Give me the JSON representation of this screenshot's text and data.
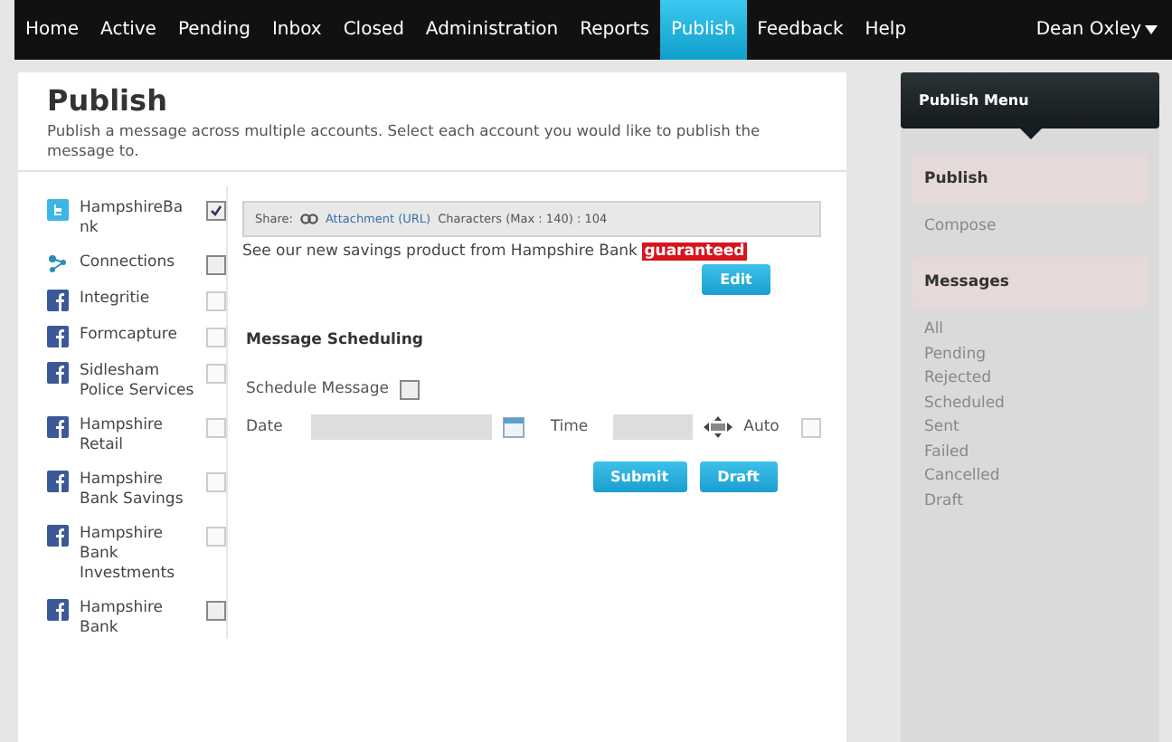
{
  "nav": {
    "items": [
      {
        "label": "Home",
        "selected": false
      },
      {
        "label": "Active",
        "selected": false
      },
      {
        "label": "Pending",
        "selected": false
      },
      {
        "label": "Inbox",
        "selected": false
      },
      {
        "label": "Closed",
        "selected": false
      },
      {
        "label": "Administration",
        "selected": false
      },
      {
        "label": "Reports",
        "selected": false
      },
      {
        "label": "Publish",
        "selected": true
      },
      {
        "label": "Feedback",
        "selected": false
      },
      {
        "label": "Help",
        "selected": false
      }
    ],
    "user": "Dean Oxley"
  },
  "page": {
    "title": "Publish",
    "description": "Publish a message across multiple accounts. Select each account you would like to publish the message to."
  },
  "accounts": [
    {
      "kind": "twitter",
      "name": "HampshireBa nk",
      "checked": true,
      "disabled": false
    },
    {
      "kind": "connections",
      "name": "Connections",
      "checked": false,
      "disabled": false
    },
    {
      "kind": "facebook",
      "name": "Integritie",
      "checked": false,
      "disabled": true
    },
    {
      "kind": "facebook",
      "name": "Formcapture",
      "checked": false,
      "disabled": true
    },
    {
      "kind": "facebook",
      "name": "Sidlesham Police Services",
      "checked": false,
      "disabled": true
    },
    {
      "kind": "facebook",
      "name": "Hampshire Retail",
      "checked": false,
      "disabled": true
    },
    {
      "kind": "facebook",
      "name": "Hampshire Bank Savings",
      "checked": false,
      "disabled": true
    },
    {
      "kind": "facebook",
      "name": "Hampshire Bank Investments",
      "checked": false,
      "disabled": true
    },
    {
      "kind": "facebook",
      "name": "Hampshire Bank",
      "checked": false,
      "disabled": false
    }
  ],
  "composer": {
    "share_label": "Share:",
    "attachment_link": "Attachment (URL)",
    "characters": "Characters (Max : 140) : 104",
    "message": "See our new savings product from Hampshire Bank",
    "highlight": "guaranteed",
    "edit_button": "Edit"
  },
  "scheduling": {
    "title": "Message Scheduling",
    "schedule_label": "Schedule Message",
    "schedule_checked": false,
    "date_label": "Date",
    "time_label": "Time",
    "auto_label": "Auto",
    "auto_checked": false,
    "buttons": [
      "Submit",
      "Draft"
    ]
  },
  "menu": {
    "title": "Publish Menu",
    "sections": [
      {
        "title": "Publish",
        "items": [
          "Compose"
        ]
      },
      {
        "title": "Messages",
        "items": [
          "All",
          "Pending",
          "Rejected",
          "Scheduled",
          "Sent",
          "Failed",
          "Cancelled",
          "Draft"
        ]
      }
    ]
  }
}
